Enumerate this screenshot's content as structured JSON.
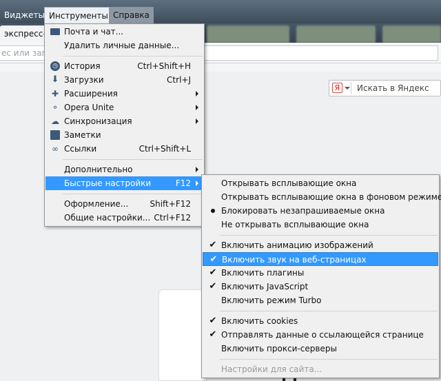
{
  "menubar": {
    "widgets": "Виджеты",
    "tools": "Инструменты",
    "help": "Справка"
  },
  "tab": {
    "label": "экспресс-па"
  },
  "address": {
    "placeholder": "ес или запр"
  },
  "search": {
    "placeholder": "Искать в Яндекс",
    "engine_glyph": "Я"
  },
  "tools_menu": {
    "mail": "Почта и чат...",
    "delete_data": "Удалить личные данные...",
    "history": {
      "label": "История",
      "shortcut": "Ctrl+Shift+H"
    },
    "downloads": {
      "label": "Загрузки",
      "shortcut": "Ctrl+J"
    },
    "extensions": "Расширения",
    "unite": "Opera Unite",
    "sync": "Синхронизация",
    "notes": "Заметки",
    "links": {
      "label": "Ссылки",
      "shortcut": "Ctrl+Shift+L"
    },
    "advanced": "Дополнительно",
    "quick_prefs": {
      "label": "Быстрые настройки",
      "shortcut": "F12"
    },
    "appearance": {
      "label": "Оформление...",
      "shortcut": "Shift+F12"
    },
    "general": {
      "label": "Общие настройки...",
      "shortcut": "Ctrl+F12"
    }
  },
  "quick_menu": {
    "popups_open": "Открывать всплывающие окна",
    "popups_background": "Открывать всплывающие окна в фоновом режиме",
    "popups_block": "Блокировать незапрашиваемые окна",
    "popups_never": "Не открывать всплывающие окна",
    "animation": "Включить анимацию изображений",
    "sound": "Включить звук на веб-страницах",
    "plugins": "Включить плагины",
    "javascript": "Включить JavaScript",
    "turbo": "Включить режим Turbo",
    "cookies": "Включить cookies",
    "referrer": "Отправлять данные о ссылающейся странице",
    "proxy": "Включить прокси-серверы",
    "site_prefs": "Настройки для сайта..."
  }
}
